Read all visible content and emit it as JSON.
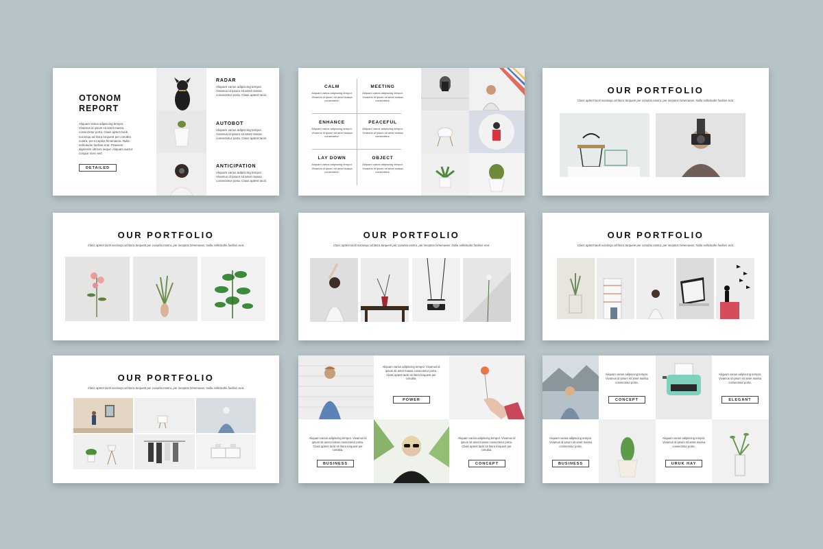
{
  "lorem_short": "Aliquam varius adipiscing tempor. Vivamus id ipsum sit amet massa consectetur porta. Class aptent taciti.",
  "lorem_med": "Aliquam varius adipiscing tempor. Vivamus id ipsum sit amet massa consectetur porta. Class aptent taciti.",
  "subtitle": "Class aptent taciti sociosqu ad litora torquent per conubia nostra, per inceptos himenaeos. Nulla sollicitudin facilisis erat.",
  "slide1": {
    "title_line1": "OTONOM",
    "title_line2": "REPORT",
    "body": "Aliquam varius adipiscing tempor. Vivamus id ipsum sit amet massa consectetur porta. Class aptent taciti sociosqu ad litora torquent per conubia nostra, per inceptos himenaeos. Nulla sollicitudin facilisis erat. Praesent dignissim ultrices neque. Aliquam auctor congue nunc sed.",
    "button": "DETAILED",
    "items": [
      {
        "heading": "RADAR",
        "text": "Aliquam varius adipiscing tempor. Vivamus id ipsum sit amet massa consectetur porta. Class aptent taciti."
      },
      {
        "heading": "AUTOBOT",
        "text": "Aliquam varius adipiscing tempor. Vivamus id ipsum sit amet massa consectetur porta. Class aptent taciti."
      },
      {
        "heading": "ANTICIPATION",
        "text": "Aliquam varius adipiscing tempor. Vivamus id ipsum sit amet massa consectetur porta. Class aptent taciti."
      }
    ]
  },
  "slide2": {
    "cells": [
      {
        "heading": "CALM",
        "text": "Aliquam varius adipiscing tempor. Vivamus id ipsum sit amet massa consectetur."
      },
      {
        "heading": "MEETING",
        "text": "Aliquam varius adipiscing tempor. Vivamus id ipsum sit amet massa consectetur."
      },
      {
        "heading": "ENHANCE",
        "text": "Aliquam varius adipiscing tempor. Vivamus id ipsum sit amet massa consectetur."
      },
      {
        "heading": "PEACEFUL",
        "text": "Aliquam varius adipiscing tempor. Vivamus id ipsum sit amet massa consectetur."
      },
      {
        "heading": "LAY DOWN",
        "text": "Aliquam varius adipiscing tempor. Vivamus id ipsum sit amet massa consectetur."
      },
      {
        "heading": "OBJECT",
        "text": "Aliquam varius adipiscing tempor. Vivamus id ipsum sit amet massa consectetur."
      }
    ]
  },
  "portfolio_title": "OUR PORTFOLIO",
  "slide8": {
    "text1": "Aliquam varius adipiscing tempor. Vivamus id ipsum sit amet massa consectetur porta. Class aptent taciti sit litora torquent per conubia.",
    "text2": "Aliquam varius adipiscing tempor. Vivamus id ipsum sit amet massa consectetur porta. Class aptent taciti sit litora torquent per conubia.",
    "text3": "Aliquam varius adipiscing tempor. Vivamus id ipsum sit amet massa consectetur porta. Class aptent taciti sit litora torquent per conubia.",
    "btn_power": "POWER",
    "btn_business": "BUSINESS",
    "btn_concept": "CONCEPT"
  },
  "slide9": {
    "text1": "Aliquam varius adipiscing tempor. Vivamus id ipsum sit amet massa consectetur porta.",
    "text2": "Aliquam varius adipiscing tempor. Vivamus id ipsum sit amet massa consectetur porta.",
    "text3": "Aliquam varius adipiscing tempor. Vivamus id ipsum sit amet massa consectetur porta.",
    "text4": "Aliquam varius adipiscing tempor. Vivamus id ipsum sit amet massa consectetur porta.",
    "btn_concept": "CONCEPT",
    "btn_elegant": "ELEGANT",
    "btn_business": "BUSINESS",
    "btn_uruk": "URUK HAY"
  },
  "colors": {
    "background": "#b6c3c7",
    "slide": "#ffffff",
    "photo_light": "#e9e9e9",
    "photo_mid": "#d6d6d6"
  }
}
